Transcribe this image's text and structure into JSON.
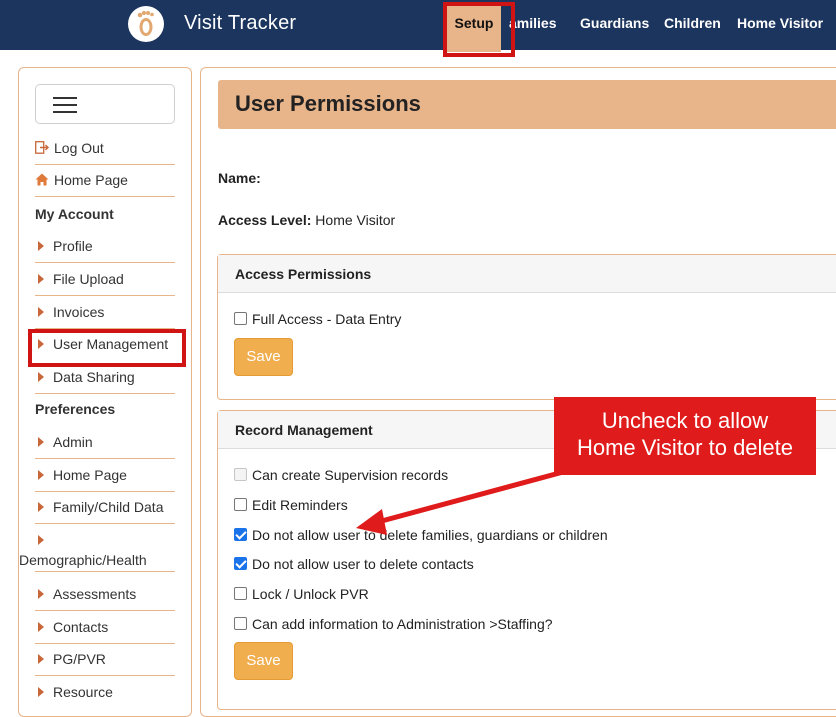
{
  "header": {
    "app_title": "Visit Tracker",
    "nav": [
      "Setup",
      "Families",
      "Guardians",
      "Children",
      "Home Visitor"
    ],
    "nav_shown": [
      "Setup",
      "amilies",
      "Guardians",
      "Children",
      "Home Visitor"
    ],
    "active_nav": "Setup",
    "colors": {
      "bar": "#1b355e",
      "active": "#e8b48a",
      "highlight": "#d01414"
    }
  },
  "sidebar": {
    "menu_icon": "hamburger-icon",
    "items": [
      {
        "label": "Log Out",
        "icon": "logout-icon"
      },
      {
        "label": "Home Page",
        "icon": "home-icon"
      },
      {
        "label": "My Account",
        "type": "heading"
      },
      {
        "label": "Profile"
      },
      {
        "label": "File Upload"
      },
      {
        "label": "Invoices"
      },
      {
        "label": "User Management",
        "highlighted": true
      },
      {
        "label": "Data Sharing"
      },
      {
        "label": "Preferences",
        "type": "heading"
      },
      {
        "label": "Admin"
      },
      {
        "label": "Home Page"
      },
      {
        "label": "Family/Child Data"
      },
      {
        "label": "Demographic/Health"
      },
      {
        "label": "Assessments"
      },
      {
        "label": "Contacts"
      },
      {
        "label": "PG/PVR"
      },
      {
        "label": "Resource"
      }
    ]
  },
  "main": {
    "title": "User Permissions",
    "name_label": "Name:",
    "name_value": "",
    "access_level_label": "Access Level:",
    "access_level_value": "Home Visitor",
    "access_permissions": {
      "heading": "Access Permissions",
      "options": [
        {
          "label": "Full Access - Data Entry",
          "checked": false
        }
      ],
      "save_label": "Save"
    },
    "record_management": {
      "heading": "Record Management",
      "options": [
        {
          "label": "Can create Supervision records",
          "checked": false,
          "disabled": true
        },
        {
          "label": "Edit Reminders",
          "checked": false
        },
        {
          "label": "Do not allow user to delete families, guardians or children",
          "checked": true
        },
        {
          "label": "Do not allow user to delete contacts",
          "checked": true
        },
        {
          "label": "Lock / Unlock PVR",
          "checked": false
        },
        {
          "label": "Can add information to Administration >Staffing?",
          "checked": false
        }
      ],
      "save_label": "Save"
    }
  },
  "annotation": {
    "text_line1": "Uncheck to allow",
    "text_line2": "Home Visitor to delete",
    "color": "#e01b1b"
  }
}
